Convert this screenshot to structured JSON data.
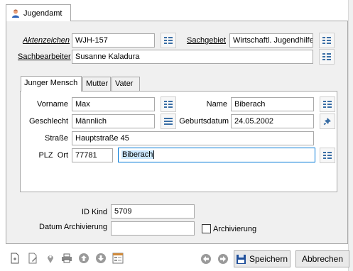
{
  "main_tab": {
    "label": "Jugendamt"
  },
  "header": {
    "aktenzeichen_label": "Aktenzeichen",
    "aktenzeichen_value": "WJH-157",
    "sachgebiet_label": "Sachgebiet",
    "sachgebiet_value": "Wirtschaftl. Jugendhilfe",
    "sachbearbeiter_label": "Sachbearbeiter",
    "sachbearbeiter_value": "Susanne Kaladura"
  },
  "sub_tabs": [
    {
      "label": "Junger Mensch"
    },
    {
      "label": "Mutter"
    },
    {
      "label": "Vater"
    }
  ],
  "person": {
    "vorname_label": "Vorname",
    "vorname_value": "Max",
    "name_label": "Name",
    "name_value": "Biberach",
    "geschlecht_label": "Geschlecht",
    "geschlecht_value": "Männlich",
    "geburtsdatum_label": "Geburtsdatum",
    "geburtsdatum_value": "24.05.2002",
    "strasse_label": "Straße",
    "strasse_value": "Hauptstraße 45",
    "plz_ort_label": "PLZ  Ort",
    "plz_value": "77781",
    "ort_value": "Biberach"
  },
  "footer_fields": {
    "id_kind_label": "ID Kind",
    "id_kind_value": "5709",
    "datum_archivierung_label": "Datum Archivierung",
    "datum_archivierung_value": "",
    "archivierung_label": "Archivierung",
    "archivierung_checked": false
  },
  "toolbar": {
    "icons": [
      "new-document-icon",
      "edit-document-icon",
      "pin-icon",
      "print-icon",
      "up-arrow-icon",
      "down-arrow-icon",
      "form-icon"
    ],
    "prev_icon": "prev-icon",
    "next_icon": "next-icon",
    "save_label": "Speichern",
    "cancel_label": "Abbrechen"
  },
  "colors": {
    "panel_bg": "#f0f0f0",
    "border": "#a8a8a8",
    "selection": "#cce8ff",
    "icon_blue": "#3a6ea5"
  }
}
